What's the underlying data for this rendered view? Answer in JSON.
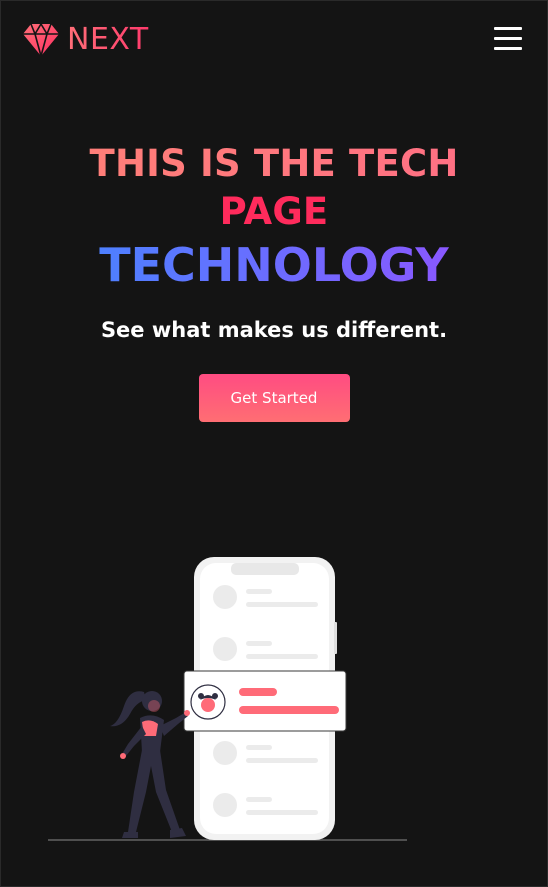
{
  "navbar": {
    "brand": "NEXT",
    "logo_icon": "diamond-icon",
    "menu_icon": "hamburger-menu-icon"
  },
  "hero": {
    "title_line_1": "THIS IS THE TECH",
    "title_line_2": "PAGE",
    "title_line_3": "TECHNOLOGY",
    "subtitle": "See what makes us different.",
    "cta_label": "Get Started"
  },
  "illustration": {
    "name": "person-with-phone-illustration"
  },
  "colors": {
    "background": "#141414",
    "brand_pink": "#ff4b6e",
    "title_pink": "#ff2b5c",
    "gradient_blue": "#3d8bff",
    "gradient_purple": "#9a4dff",
    "button": "#ff5c79"
  }
}
